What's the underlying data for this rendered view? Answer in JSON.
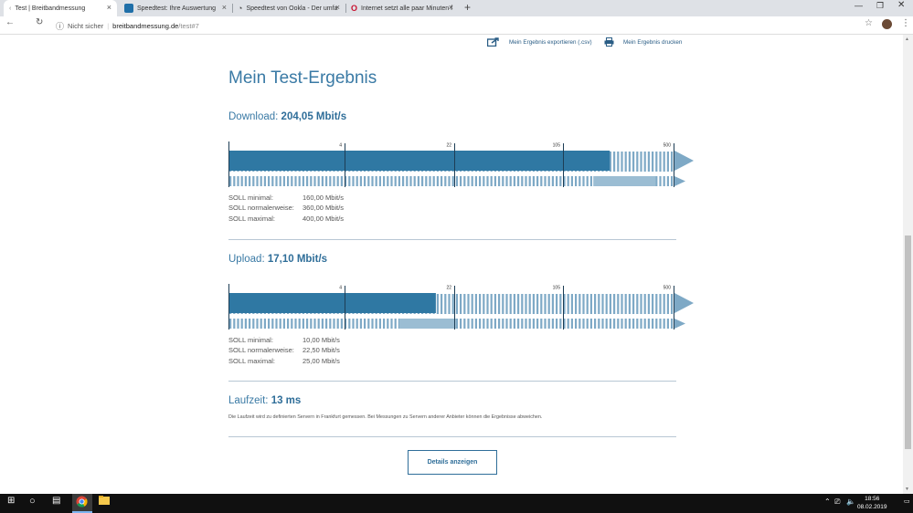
{
  "browser": {
    "tabs": [
      {
        "label": "Test | Breitbandmessung",
        "active": true
      },
      {
        "label": "Speedtest: Ihre Auswertung",
        "active": false
      },
      {
        "label": "Speedtest von Ookla - Der umfa",
        "active": false
      },
      {
        "label": "Internet setzt alle paar Minuten f",
        "active": false
      }
    ],
    "security_label": "Nicht sicher",
    "url_host": "breitbandmessung.de",
    "url_path": "/test#7"
  },
  "page": {
    "export_label": "Mein Ergebnis exportieren (.csv)",
    "print_label": "Mein Ergebnis drucken",
    "title": "Mein Test-Ergebnis",
    "download": {
      "label": "Download:",
      "value": "204,05 Mbit/s",
      "scale_ticks": [
        "4",
        "22",
        "105",
        "500"
      ],
      "measured_fraction": 0.855,
      "soll_range": [
        0.818,
        0.958
      ],
      "soll": [
        {
          "key": "SOLL minimal:",
          "value": "160,00 Mbit/s"
        },
        {
          "key": "SOLL normalerweise:",
          "value": "360,00 Mbit/s"
        },
        {
          "key": "SOLL maximal:",
          "value": "400,00 Mbit/s"
        }
      ]
    },
    "upload": {
      "label": "Upload:",
      "value": "17,10 Mbit/s",
      "scale_ticks": [
        "4",
        "22",
        "105",
        "500"
      ],
      "measured_fraction": 0.465,
      "soll_range": [
        0.383,
        0.51
      ],
      "soll": [
        {
          "key": "SOLL minimal:",
          "value": "10,00 Mbit/s"
        },
        {
          "key": "SOLL normalerweise:",
          "value": "22,50 Mbit/s"
        },
        {
          "key": "SOLL maximal:",
          "value": "25,00 Mbit/s"
        }
      ]
    },
    "latency": {
      "label": "Laufzeit:",
      "value": "13 ms",
      "note": "Die Laufzeit wird zu definierten Servern in Frankfurt gemessen. Bei Messungen zu Servern anderer Anbieter können die Ergebnisse abweichen."
    },
    "details_button": "Details anzeigen"
  },
  "taskbar": {
    "time": "18:56",
    "date": "08.02.2019"
  },
  "colors": {
    "accent": "#2f6e99",
    "bar_dark": "#2f78a3",
    "bar_light": "#9bbdd3",
    "stripe": "#7ea9c6"
  }
}
